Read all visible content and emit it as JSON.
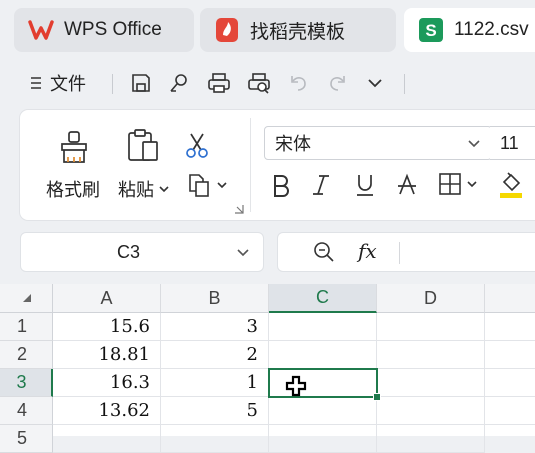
{
  "tabs": [
    {
      "label": "WPS Office",
      "icon": "wps-logo-icon"
    },
    {
      "label": "找稻壳模板",
      "icon": "docer-logo-icon"
    },
    {
      "label": "1122.csv",
      "icon": "spreadsheet-s-icon"
    }
  ],
  "quickbar": {
    "menu_label": "文件"
  },
  "ribbon": {
    "format_painter": "格式刷",
    "paste": "粘贴",
    "font_name": "宋体",
    "font_size": "11"
  },
  "namebox": {
    "value": "C3"
  },
  "formula": {
    "fx": "fx",
    "value": ""
  },
  "grid": {
    "columns": [
      "A",
      "B",
      "C",
      "D"
    ],
    "rows": [
      "1",
      "2",
      "3",
      "4",
      "5"
    ],
    "cells": [
      [
        "15.6",
        "3",
        "",
        ""
      ],
      [
        "18.81",
        "2",
        "",
        ""
      ],
      [
        "16.3",
        "1",
        "",
        ""
      ],
      [
        "13.62",
        "5",
        "",
        ""
      ]
    ],
    "selected": "C3"
  },
  "colors": {
    "accent": "#1f7a4c",
    "wps_red": "#e23d2f",
    "sheet_green": "#1c9a5b"
  }
}
